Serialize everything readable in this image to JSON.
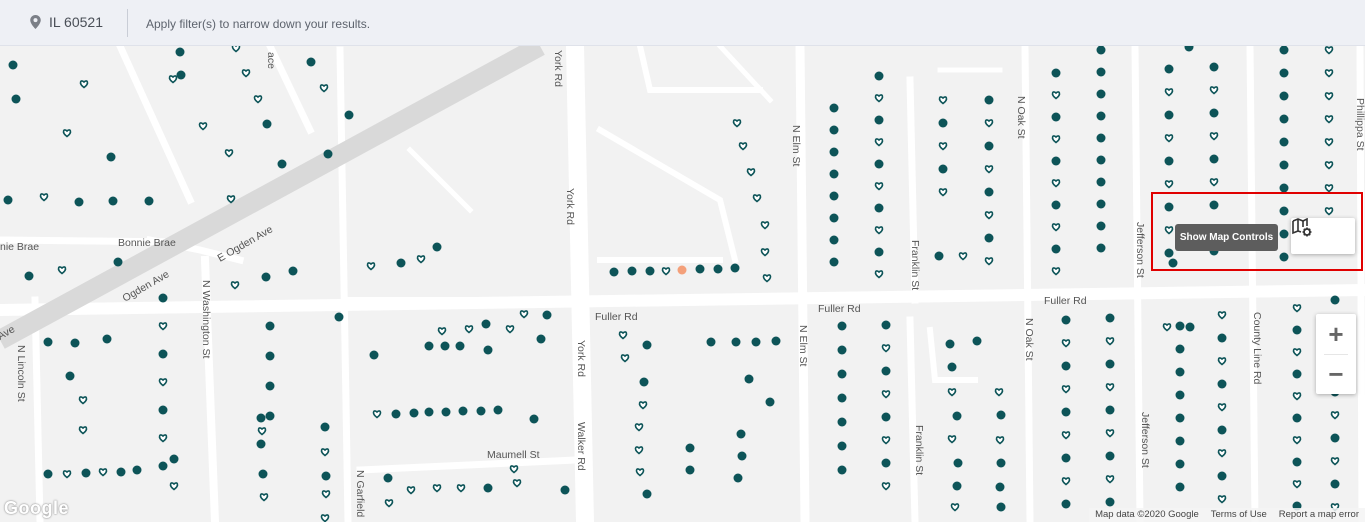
{
  "header": {
    "location_icon": "map-pin-icon",
    "location": "IL 60521",
    "filter_hint": "Apply filter(s) to narrow down your results."
  },
  "map": {
    "streets": {
      "york_rd": "York Rd",
      "e_ogden_ave": "E Ogden Ave",
      "ogden_ave": "Ogden Ave",
      "ave_fragment": "Ave",
      "bonnie_brae": "Bonnie Brae",
      "bonnie_brae_fragment": "nie Brae",
      "n_washington_st": "N Washington St",
      "n_lincoln_st": "N Lincoln St",
      "n_garfield": "N Garfield",
      "maumell_st": "Maumell St",
      "walker_rd": "Walker Rd",
      "fuller_rd": "Fuller Rd",
      "n_elm_st": "N Elm St",
      "franklin_st": "Franklin St",
      "n_oak_st": "N Oak St",
      "jefferson_st": "Jefferson St",
      "county_line_rd": "County Line Rd",
      "phillippa_st": "Phillippa St",
      "ace_fragment": "ace"
    },
    "colors": {
      "marker": "#0d5458",
      "highlight_marker": "#f4a07a",
      "road": "#ffffff",
      "highway": "#d9d9d9",
      "background": "#f2f2f2"
    }
  },
  "controls": {
    "tooltip": "Show Map Controls",
    "map_controls_icon": "map-settings-icon",
    "zoom_in": "+",
    "zoom_out": "−"
  },
  "attribution": {
    "logo": "Google",
    "map_data": "Map data ©2020 Google",
    "terms": "Terms of Use",
    "report": "Report a map error"
  }
}
